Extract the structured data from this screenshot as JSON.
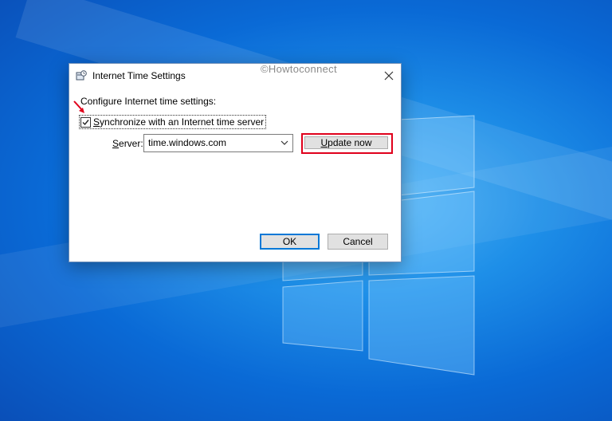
{
  "dialog": {
    "title": "Internet Time Settings",
    "watermark": "©Howtoconnect",
    "heading": "Configure Internet time settings:",
    "sync_checkbox": {
      "label_first": "S",
      "label_rest": "ynchronize with an Internet time server",
      "checked": true
    },
    "server": {
      "label_first": "S",
      "label_rest": "erver:",
      "value": "time.windows.com"
    },
    "update_button": {
      "label_first": "U",
      "label_rest": "pdate now"
    },
    "ok_label": "OK",
    "cancel_label": "Cancel"
  },
  "colors": {
    "accent": "#0078d7",
    "highlight_red": "#e0001b",
    "desktop_blue": "#0a6ad6"
  },
  "icons": [
    "clock-settings-icon",
    "close-icon",
    "chevron-down-icon",
    "red-arrow-icon",
    "checkmark-icon"
  ]
}
